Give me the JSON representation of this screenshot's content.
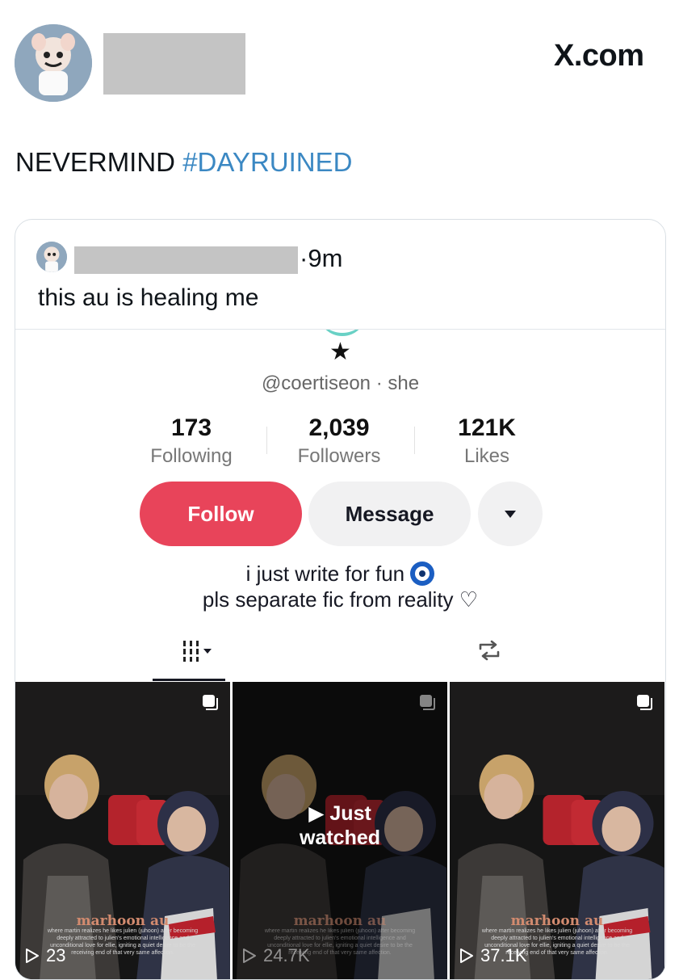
{
  "header": {
    "brand": "X.com"
  },
  "tweet": {
    "text": "NEVERMIND ",
    "hashtag": "#DAYRUINED"
  },
  "quote": {
    "time": "·9m",
    "text": "this au is healing me"
  },
  "profile": {
    "handle": "@coertiseon · she",
    "stats": [
      {
        "value": "173",
        "label": "Following"
      },
      {
        "value": "2,039",
        "label": "Followers"
      },
      {
        "value": "121K",
        "label": "Likes"
      }
    ],
    "follow_label": "Follow",
    "message_label": "Message",
    "bio_line1": "i just write for fun ",
    "bio_line2": "pls separate fic from reality ♡",
    "accent": "#e8445a"
  },
  "videos": [
    {
      "title": "marhoon au",
      "count": "23",
      "caption": "where martin realizes he likes julien (juhoon) after becoming deeply attracted to julien's emotional intelligence and unconditional love for ellie, igniting a quiet desire to be the receiving end of that very same affection."
    },
    {
      "title": "marhoon au",
      "count": "24.7K",
      "overlay": "▶ Just\nwatched",
      "overlay_line1": "Just",
      "overlay_line2": "watched",
      "caption": "where martin realizes he likes julien (juhoon) after becoming deeply attracted to julien's emotional intelligence and unconditional love for ellie, igniting a quiet desire to be the receiving end of that very same affection."
    },
    {
      "title": "marhoon au",
      "count": "37.1K",
      "caption": "where martin realizes he likes julien (juhoon) after becoming deeply attracted to julien's emotional intelligence and unconditional love for ellie, igniting a quiet desire to be the receiving end of that very same affection."
    }
  ]
}
